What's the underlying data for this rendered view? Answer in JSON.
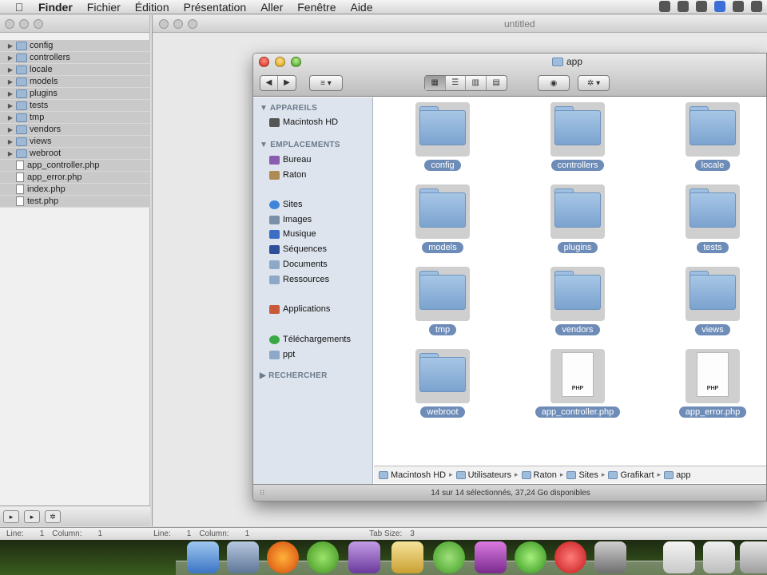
{
  "menubar": {
    "items": [
      "Finder",
      "Fichier",
      "Édition",
      "Présentation",
      "Aller",
      "Fenêtre",
      "Aide"
    ]
  },
  "editor": {
    "title": "untitled",
    "tree": [
      {
        "label": "config",
        "type": "folder"
      },
      {
        "label": "controllers",
        "type": "folder"
      },
      {
        "label": "locale",
        "type": "folder"
      },
      {
        "label": "models",
        "type": "folder"
      },
      {
        "label": "plugins",
        "type": "folder"
      },
      {
        "label": "tests",
        "type": "folder"
      },
      {
        "label": "tmp",
        "type": "folder"
      },
      {
        "label": "vendors",
        "type": "folder"
      },
      {
        "label": "views",
        "type": "folder"
      },
      {
        "label": "webroot",
        "type": "folder"
      },
      {
        "label": "app_controller.php",
        "type": "file"
      },
      {
        "label": "app_error.php",
        "type": "file"
      },
      {
        "label": "index.php",
        "type": "file"
      },
      {
        "label": "test.php",
        "type": "file"
      }
    ],
    "status_left": {
      "line_label": "Line:",
      "line": "1",
      "column_label": "Column:",
      "column": "1"
    },
    "status_right": {
      "line_label": "Line:",
      "line": "1",
      "column_label": "Column:",
      "column": "1",
      "tab_label": "Tab Size:",
      "tab": "3"
    }
  },
  "finder": {
    "title": "app",
    "sidebar": {
      "devices_header": "APPAREILS",
      "devices": [
        "Macintosh HD"
      ],
      "places_header": "EMPLACEMENTS",
      "places": [
        "Bureau",
        "Raton",
        "Sites",
        "Images",
        "Musique",
        "Séquences",
        "Documents",
        "Ressources",
        "Applications",
        "Téléchargements",
        "ppt"
      ],
      "search_header": "RECHERCHER"
    },
    "items": [
      {
        "label": "config",
        "type": "folder"
      },
      {
        "label": "controllers",
        "type": "folder"
      },
      {
        "label": "locale",
        "type": "folder"
      },
      {
        "label": "models",
        "type": "folder"
      },
      {
        "label": "plugins",
        "type": "folder"
      },
      {
        "label": "tests",
        "type": "folder"
      },
      {
        "label": "tmp",
        "type": "folder"
      },
      {
        "label": "vendors",
        "type": "folder"
      },
      {
        "label": "views",
        "type": "folder"
      },
      {
        "label": "webroot",
        "type": "folder"
      },
      {
        "label": "app_controller.php",
        "type": "php"
      },
      {
        "label": "app_error.php",
        "type": "php"
      }
    ],
    "php_tag": "PHP",
    "path": [
      "Macintosh HD",
      "Utilisateurs",
      "Raton",
      "Sites",
      "Grafikart",
      "app"
    ],
    "status": "14 sur 14 sélectionnés, 37,24 Go disponibles"
  },
  "colors": {
    "selection_pill": "#6e8cb8",
    "sidebar_bg": "#dde4ed",
    "folder_blue": "#7ba3cf"
  }
}
